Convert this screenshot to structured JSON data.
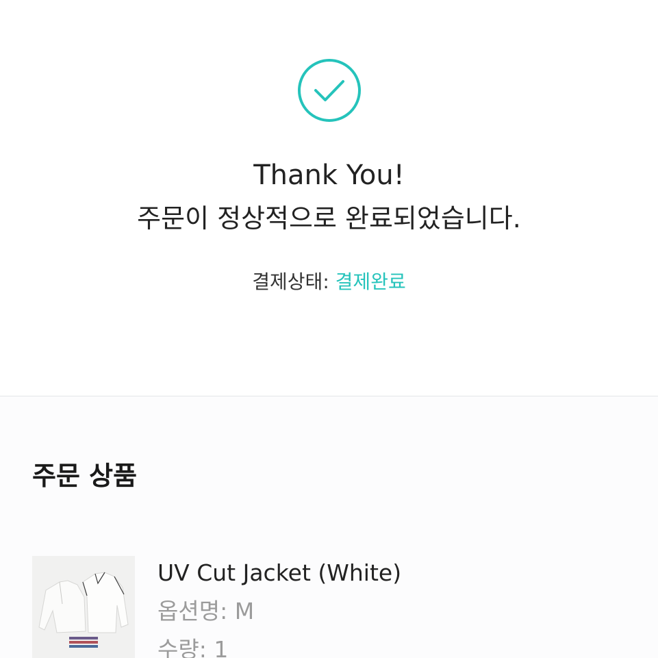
{
  "confirmation": {
    "icon": "check-circle-icon",
    "accent_color": "#25c3bb",
    "heading": "Thank You!",
    "message": "주문이 정상적으로 완료되었습니다.",
    "status_label": "결제상태:",
    "status_value": "결제완료"
  },
  "order_items": {
    "title": "주문 상품",
    "items": [
      {
        "name": "UV Cut Jacket (White)",
        "option": "옵션명: M",
        "quantity": "수량: 1",
        "thumbnail_icon": "jacket-image"
      }
    ]
  }
}
